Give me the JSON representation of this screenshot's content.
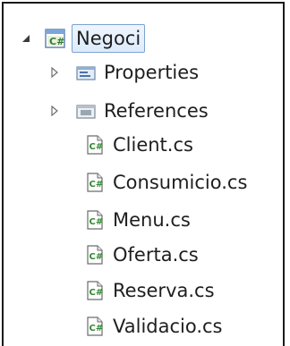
{
  "solution_explorer": {
    "project": {
      "name": "Negoci",
      "expanded": true,
      "icon": "csharp-project-icon"
    },
    "folders": [
      {
        "name": "Properties",
        "icon": "properties-folder-icon",
        "expanded": false
      },
      {
        "name": "References",
        "icon": "references-folder-icon",
        "expanded": false
      }
    ],
    "files": [
      {
        "name": "Client.cs",
        "icon": "csharp-file-icon"
      },
      {
        "name": "Consumicio.cs",
        "icon": "csharp-file-icon"
      },
      {
        "name": "Menu.cs",
        "icon": "csharp-file-icon"
      },
      {
        "name": "Oferta.cs",
        "icon": "csharp-file-icon"
      },
      {
        "name": "Reserva.cs",
        "icon": "csharp-file-icon"
      },
      {
        "name": "Validacio.cs",
        "icon": "csharp-file-icon"
      }
    ]
  },
  "colors": {
    "text": "#1e1e1e",
    "selection_border": "#7da2ce",
    "selection_fill": "#dcebfc",
    "frame_border": "#1a1a1a"
  }
}
